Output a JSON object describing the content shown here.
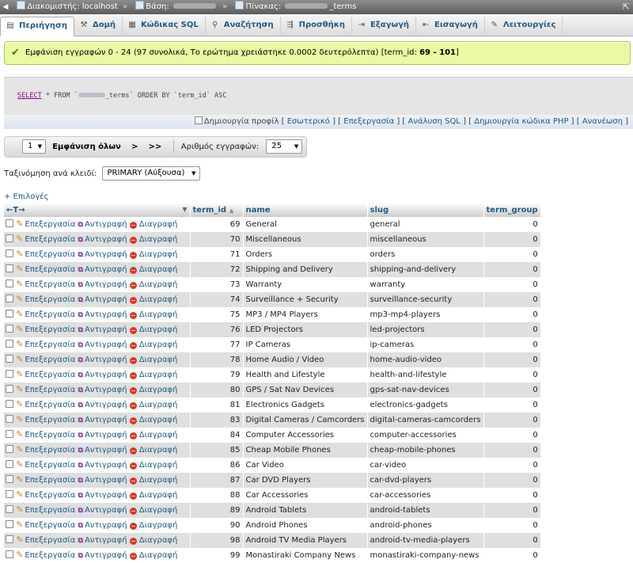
{
  "breadcrumb": {
    "server_label": "Διακομιστής: localhost",
    "db_label": "Βάση:",
    "table_label": "Πίνακας:",
    "table_suffix": "_terms",
    "sep": "»"
  },
  "tabs": [
    {
      "label": "Περιήγηση",
      "icon": "browse-icon"
    },
    {
      "label": "Δομή",
      "icon": "structure-icon"
    },
    {
      "label": "Κώδικας SQL",
      "icon": "sql-icon"
    },
    {
      "label": "Αναζήτηση",
      "icon": "search-icon"
    },
    {
      "label": "Προσθήκη",
      "icon": "insert-icon"
    },
    {
      "label": "Εξαγωγή",
      "icon": "export-icon"
    },
    {
      "label": "Εισαγωγή",
      "icon": "import-icon"
    },
    {
      "label": "Λειτουργίες",
      "icon": "operations-icon"
    }
  ],
  "message": {
    "text": "Εμφάνιση εγγραφών 0 - 24 (97 συνολικά, Το ερώτημα χρειάστηκε 0.0002 δευτερόλεπτα) [term_id: ",
    "b1": "69",
    "mid": " - ",
    "b2": "101",
    "end": "]"
  },
  "sql": {
    "select": "SELECT",
    "star_from": "* FROM `",
    "table_tail": "_terms` ORDER BY `term_id` ASC"
  },
  "sql_links": {
    "profile": "Δημιουργία προφίλ",
    "inline": "Εσωτερικό",
    "edit": "Επεξεργασία",
    "explain": "Ανάλυση SQL",
    "php": "Δημιουργία κώδικα PHP",
    "refresh": "Ανανέωση"
  },
  "nav": {
    "page_value": "1",
    "show_all": "Εμφάνιση όλων",
    "next": ">",
    "last": ">>",
    "rows_label": "Αριθμός εγγραφών:",
    "rows_value": "25"
  },
  "sort": {
    "label": "Ταξινόμηση ανά κλειδί:",
    "value": "PRIMARY (Αύξουσα)"
  },
  "options_label": "+ Επιλογές",
  "table": {
    "arrows": "←T→",
    "headers": [
      "term_id",
      "name",
      "slug",
      "term_group"
    ],
    "actions": {
      "edit": "Επεξεργασία",
      "copy": "Αντιγραφή",
      "delete": "Διαγραφή"
    },
    "rows": [
      [
        "69",
        "General",
        "general",
        "0"
      ],
      [
        "70",
        "Miscellaneous",
        "miscellaneous",
        "0"
      ],
      [
        "71",
        "Orders",
        "orders",
        "0"
      ],
      [
        "72",
        "Shipping and Delivery",
        "shipping-and-delivery",
        "0"
      ],
      [
        "73",
        "Warranty",
        "warranty",
        "0"
      ],
      [
        "74",
        "Surveillance + Security",
        "surveillance-security",
        "0"
      ],
      [
        "75",
        "MP3 / MP4 Players",
        "mp3-mp4-players",
        "0"
      ],
      [
        "76",
        "LED Projectors",
        "led-projectors",
        "0"
      ],
      [
        "77",
        "IP Cameras",
        "ip-cameras",
        "0"
      ],
      [
        "78",
        "Home Audio / Video",
        "home-audio-video",
        "0"
      ],
      [
        "79",
        "Health and Lifestyle",
        "health-and-lifestyle",
        "0"
      ],
      [
        "80",
        "GPS / Sat Nav Devices",
        "gps-sat-nav-devices",
        "0"
      ],
      [
        "81",
        "Electronics Gadgets",
        "electronics-gadgets",
        "0"
      ],
      [
        "83",
        "Digital Cameras / Camcorders",
        "digital-cameras-camcorders",
        "0"
      ],
      [
        "84",
        "Computer Accessories",
        "computer-accessories",
        "0"
      ],
      [
        "85",
        "Cheap Mobile Phones",
        "cheap-mobile-phones",
        "0"
      ],
      [
        "86",
        "Car Video",
        "car-video",
        "0"
      ],
      [
        "87",
        "Car DVD Players",
        "car-dvd-players",
        "0"
      ],
      [
        "88",
        "Car Accessories",
        "car-accessories",
        "0"
      ],
      [
        "89",
        "Android Tablets",
        "android-tablets",
        "0"
      ],
      [
        "90",
        "Android Phones",
        "android-phones",
        "0"
      ],
      [
        "98",
        "Android TV Media Players",
        "android-tv-media-players",
        "0"
      ],
      [
        "99",
        "Monastiraki Company News",
        "monastiraki-company-news",
        "0"
      ]
    ]
  }
}
